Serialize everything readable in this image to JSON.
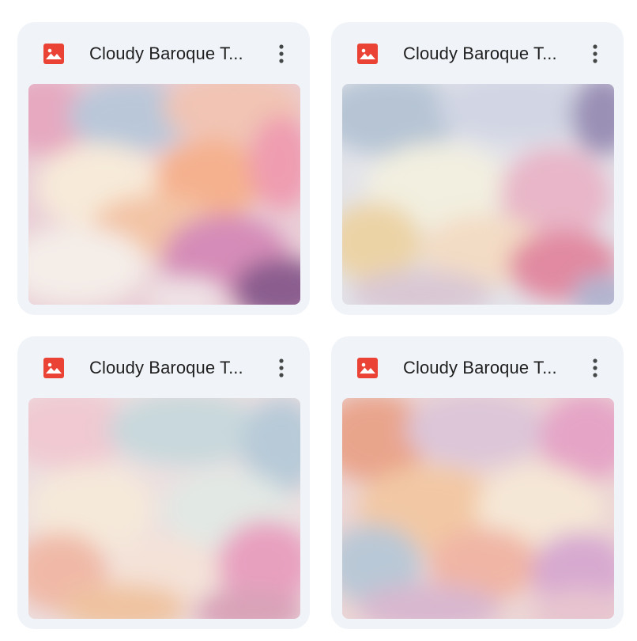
{
  "files": [
    {
      "name": "Cloudy Baroque T...",
      "icon": "image-file-icon",
      "menu_icon": "more-vert-icon"
    },
    {
      "name": "Cloudy Baroque T...",
      "icon": "image-file-icon",
      "menu_icon": "more-vert-icon"
    },
    {
      "name": "Cloudy Baroque T...",
      "icon": "image-file-icon",
      "menu_icon": "more-vert-icon"
    },
    {
      "name": "Cloudy Baroque T...",
      "icon": "image-file-icon",
      "menu_icon": "more-vert-icon"
    }
  ],
  "colors": {
    "card_background": "#f0f4f9",
    "icon_red": "#ea4335",
    "text": "#1f1f1f",
    "menu_dots": "#444746"
  }
}
